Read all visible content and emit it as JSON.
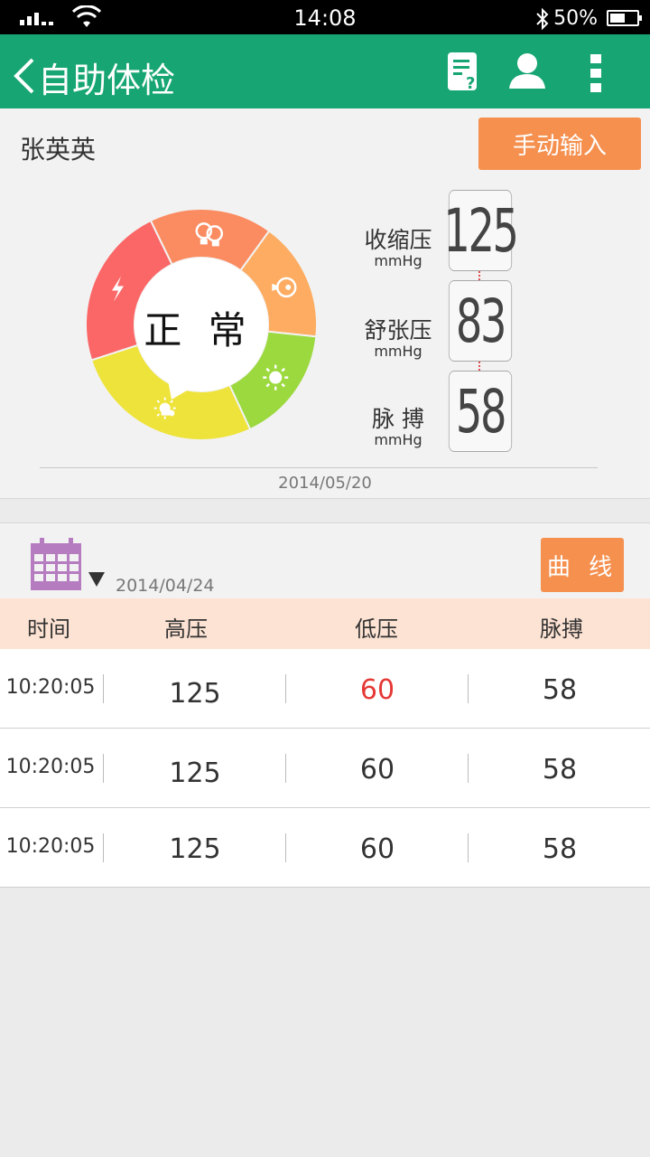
{
  "status_bar": {
    "time": "14:08",
    "battery": "50%"
  },
  "app_bar": {
    "title": "自助体检",
    "icons": [
      "back-chevron-icon",
      "report-question-icon",
      "user-icon",
      "more-vert-icon"
    ]
  },
  "profile": {
    "name": "张英英",
    "manual_input_label": "手动输入"
  },
  "gauge": {
    "status": "正 常",
    "segments": [
      {
        "icon": "lightning-icon",
        "color": "#fb6767"
      },
      {
        "icon": "boxing-gloves-icon",
        "color": "#fb8c61"
      },
      {
        "icon": "heart-mood-icon",
        "color": "#fdac61"
      },
      {
        "icon": "sun-icon",
        "color": "#9bd93e"
      },
      {
        "icon": "sun-cloud-icon",
        "color": "#eee33a"
      }
    ]
  },
  "readings": {
    "systolic": {
      "label": "收缩压",
      "unit": "mmHg",
      "value": "125"
    },
    "diastolic": {
      "label": "舒张压",
      "unit": "mmHg",
      "value": "83"
    },
    "pulse": {
      "label": "脉 搏",
      "unit": "mmHg",
      "value": "58"
    },
    "date": "2014/05/20"
  },
  "filter": {
    "date": "2014/04/24",
    "curve_label": "曲 线"
  },
  "table": {
    "headers": [
      "时间",
      "高压",
      "低压",
      "脉搏"
    ],
    "rows": [
      {
        "time": "10:20:05",
        "high": "125",
        "low": "60",
        "pulse": "58",
        "low_alert": true
      },
      {
        "time": "10:20:05",
        "high": "125",
        "low": "60",
        "pulse": "58",
        "low_alert": false
      },
      {
        "time": "10:20:05",
        "high": "125",
        "low": "60",
        "pulse": "58",
        "low_alert": false
      }
    ]
  },
  "colors": {
    "primary": "#17a673",
    "accent": "#f5904f",
    "alert": "#e53935",
    "header_bg": "#fde3d3",
    "calendar": "#b57cc0"
  }
}
